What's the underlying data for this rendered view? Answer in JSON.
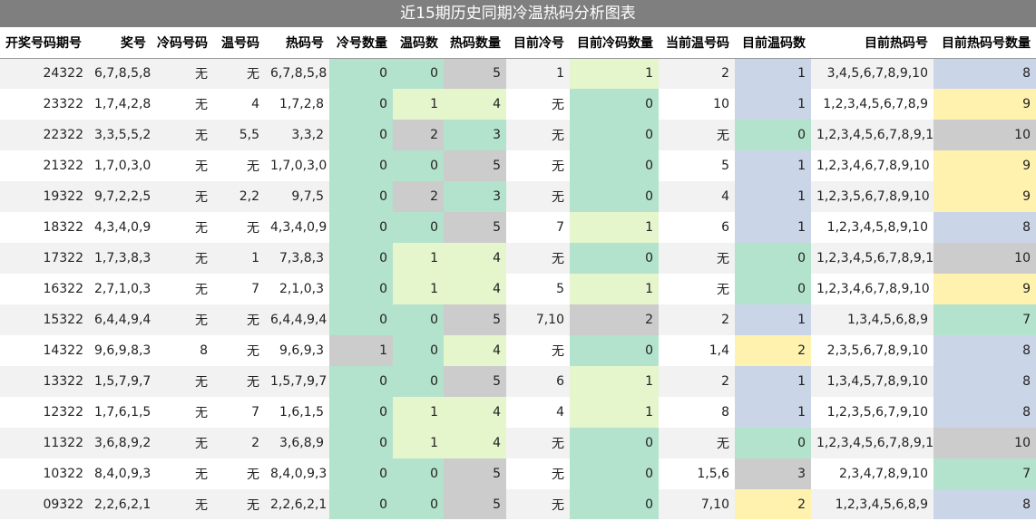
{
  "title": "近15期历史同期冷温热码分析图表",
  "colors": {
    "green": "#b3e2cd",
    "lightgreen": "#e5f5cc",
    "gray": "#cccccc",
    "blue": "#cbd5e8",
    "yellow": "#fff2ae"
  },
  "headers": [
    "开奖号码期号",
    "奖号",
    "冷码号码",
    "温号码",
    "热码号",
    "冷号数量",
    "温码数",
    "热码数量",
    "目前冷号",
    "目前冷码数量",
    "当前温号码",
    "目前温码数",
    "目前热码号",
    "目前热码号数量"
  ],
  "rows": [
    {
      "cells": [
        "24322",
        "6,7,8,5,8",
        "无",
        "无",
        "6,7,8,5,8",
        "0",
        "0",
        "5",
        "1",
        "1",
        "2",
        "1",
        "3,4,5,6,7,8,9,10",
        "8"
      ],
      "bg": [
        null,
        null,
        null,
        null,
        null,
        "green",
        "green",
        "gray",
        null,
        "lightgreen",
        null,
        "blue",
        null,
        "blue"
      ]
    },
    {
      "cells": [
        "23322",
        "1,7,4,2,8",
        "无",
        "4",
        "1,7,2,8",
        "0",
        "1",
        "4",
        "无",
        "0",
        "10",
        "1",
        "1,2,3,4,5,6,7,8,9",
        "9"
      ],
      "bg": [
        null,
        null,
        null,
        null,
        null,
        "green",
        "lightgreen",
        "lightgreen",
        null,
        "green",
        null,
        "blue",
        null,
        "yellow"
      ]
    },
    {
      "cells": [
        "22322",
        "3,3,5,5,2",
        "无",
        "5,5",
        "3,3,2",
        "0",
        "2",
        "3",
        "无",
        "0",
        "无",
        "0",
        "1,2,3,4,5,6,7,8,9,10",
        "10"
      ],
      "bg": [
        null,
        null,
        null,
        null,
        null,
        "green",
        "gray",
        "green",
        null,
        "green",
        null,
        "green",
        null,
        "gray"
      ]
    },
    {
      "cells": [
        "21322",
        "1,7,0,3,0",
        "无",
        "无",
        "1,7,0,3,0",
        "0",
        "0",
        "5",
        "无",
        "0",
        "5",
        "1",
        "1,2,3,4,6,7,8,9,10",
        "9"
      ],
      "bg": [
        null,
        null,
        null,
        null,
        null,
        "green",
        "green",
        "gray",
        null,
        "green",
        null,
        "blue",
        null,
        "yellow"
      ]
    },
    {
      "cells": [
        "19322",
        "9,7,2,2,5",
        "无",
        "2,2",
        "9,7,5",
        "0",
        "2",
        "3",
        "无",
        "0",
        "4",
        "1",
        "1,2,3,5,6,7,8,9,10",
        "9"
      ],
      "bg": [
        null,
        null,
        null,
        null,
        null,
        "green",
        "gray",
        "green",
        null,
        "green",
        null,
        "blue",
        null,
        "yellow"
      ]
    },
    {
      "cells": [
        "18322",
        "4,3,4,0,9",
        "无",
        "无",
        "4,3,4,0,9",
        "0",
        "0",
        "5",
        "7",
        "1",
        "6",
        "1",
        "1,2,3,4,5,8,9,10",
        "8"
      ],
      "bg": [
        null,
        null,
        null,
        null,
        null,
        "green",
        "green",
        "gray",
        null,
        "lightgreen",
        null,
        "blue",
        null,
        "blue"
      ]
    },
    {
      "cells": [
        "17322",
        "1,7,3,8,3",
        "无",
        "1",
        "7,3,8,3",
        "0",
        "1",
        "4",
        "无",
        "0",
        "无",
        "0",
        "1,2,3,4,5,6,7,8,9,10",
        "10"
      ],
      "bg": [
        null,
        null,
        null,
        null,
        null,
        "green",
        "lightgreen",
        "lightgreen",
        null,
        "green",
        null,
        "green",
        null,
        "gray"
      ]
    },
    {
      "cells": [
        "16322",
        "2,7,1,0,3",
        "无",
        "7",
        "2,1,0,3",
        "0",
        "1",
        "4",
        "5",
        "1",
        "无",
        "0",
        "1,2,3,4,6,7,8,9,10",
        "9"
      ],
      "bg": [
        null,
        null,
        null,
        null,
        null,
        "green",
        "lightgreen",
        "lightgreen",
        null,
        "lightgreen",
        null,
        "green",
        null,
        "yellow"
      ]
    },
    {
      "cells": [
        "15322",
        "6,4,4,9,4",
        "无",
        "无",
        "6,4,4,9,4",
        "0",
        "0",
        "5",
        "7,10",
        "2",
        "2",
        "1",
        "1,3,4,5,6,8,9",
        "7"
      ],
      "bg": [
        null,
        null,
        null,
        null,
        null,
        "green",
        "green",
        "gray",
        null,
        "gray",
        null,
        "blue",
        null,
        "green"
      ]
    },
    {
      "cells": [
        "14322",
        "9,6,9,8,3",
        "8",
        "无",
        "9,6,9,3",
        "1",
        "0",
        "4",
        "无",
        "0",
        "1,4",
        "2",
        "2,3,5,6,7,8,9,10",
        "8"
      ],
      "bg": [
        null,
        null,
        null,
        null,
        null,
        "gray",
        "green",
        "lightgreen",
        null,
        "green",
        null,
        "yellow",
        null,
        "blue"
      ]
    },
    {
      "cells": [
        "13322",
        "1,5,7,9,7",
        "无",
        "无",
        "1,5,7,9,7",
        "0",
        "0",
        "5",
        "6",
        "1",
        "2",
        "1",
        "1,3,4,5,7,8,9,10",
        "8"
      ],
      "bg": [
        null,
        null,
        null,
        null,
        null,
        "green",
        "green",
        "gray",
        null,
        "lightgreen",
        null,
        "blue",
        null,
        "blue"
      ]
    },
    {
      "cells": [
        "12322",
        "1,7,6,1,5",
        "无",
        "7",
        "1,6,1,5",
        "0",
        "1",
        "4",
        "4",
        "1",
        "8",
        "1",
        "1,2,3,5,6,7,9,10",
        "8"
      ],
      "bg": [
        null,
        null,
        null,
        null,
        null,
        "green",
        "lightgreen",
        "lightgreen",
        null,
        "lightgreen",
        null,
        "blue",
        null,
        "blue"
      ]
    },
    {
      "cells": [
        "11322",
        "3,6,8,9,2",
        "无",
        "2",
        "3,6,8,9",
        "0",
        "1",
        "4",
        "无",
        "0",
        "无",
        "0",
        "1,2,3,4,5,6,7,8,9,10",
        "10"
      ],
      "bg": [
        null,
        null,
        null,
        null,
        null,
        "green",
        "lightgreen",
        "lightgreen",
        null,
        "green",
        null,
        "green",
        null,
        "gray"
      ]
    },
    {
      "cells": [
        "10322",
        "8,4,0,9,3",
        "无",
        "无",
        "8,4,0,9,3",
        "0",
        "0",
        "5",
        "无",
        "0",
        "1,5,6",
        "3",
        "2,3,4,7,8,9,10",
        "7"
      ],
      "bg": [
        null,
        null,
        null,
        null,
        null,
        "green",
        "green",
        "gray",
        null,
        "green",
        null,
        "gray",
        null,
        "green"
      ]
    },
    {
      "cells": [
        "09322",
        "2,2,6,2,1",
        "无",
        "无",
        "2,2,6,2,1",
        "0",
        "0",
        "5",
        "无",
        "0",
        "7,10",
        "2",
        "1,2,3,4,5,6,8,9",
        "8"
      ],
      "bg": [
        null,
        null,
        null,
        null,
        null,
        "green",
        "green",
        "gray",
        null,
        "green",
        null,
        "yellow",
        null,
        "blue"
      ]
    }
  ]
}
